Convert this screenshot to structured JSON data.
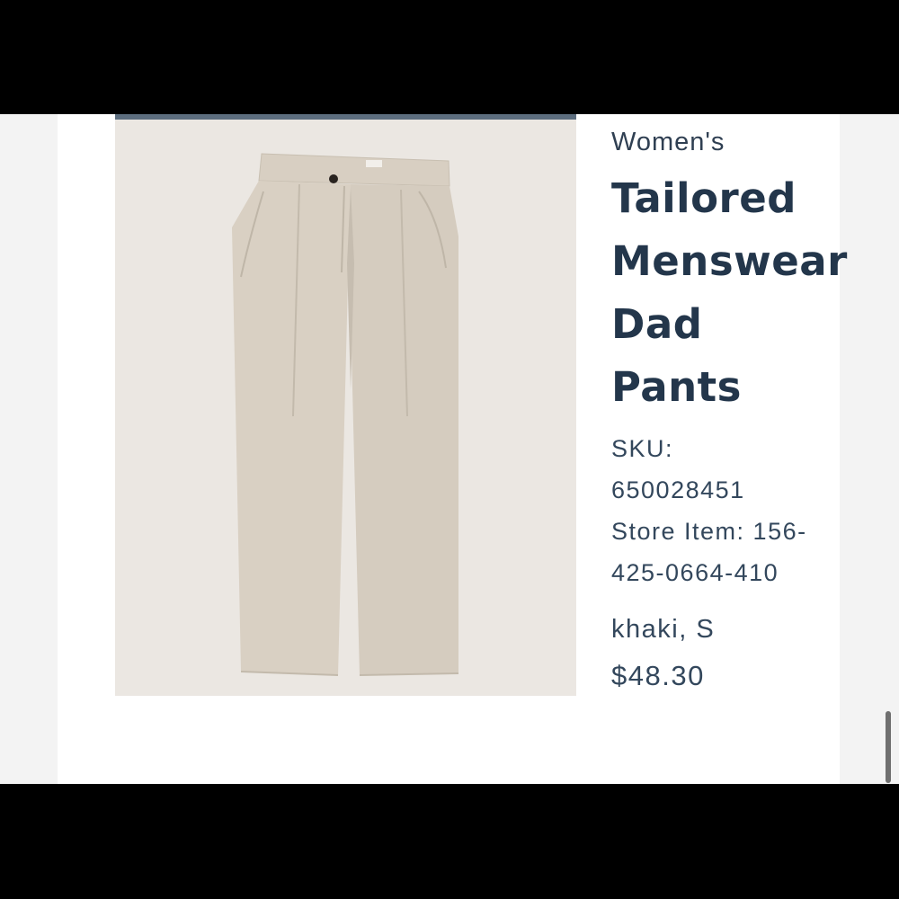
{
  "product": {
    "category": "Women's",
    "title_lines": [
      "Tailored",
      "Menswear",
      "Dad",
      "Pants"
    ],
    "sku_label": "SKU:",
    "sku_value": "650028451",
    "store_item_line1": "Store Item: 156-",
    "store_item_line2": "425-0664-410",
    "variant": "khaki, S",
    "price": "$48.30",
    "image_icon": "khaki-pants-photo"
  },
  "colors": {
    "text": "#23364b",
    "image_accent_bar": "#5d6e7f",
    "pants": "#d9d0c3",
    "photo_bg": "#ebe7e2"
  }
}
